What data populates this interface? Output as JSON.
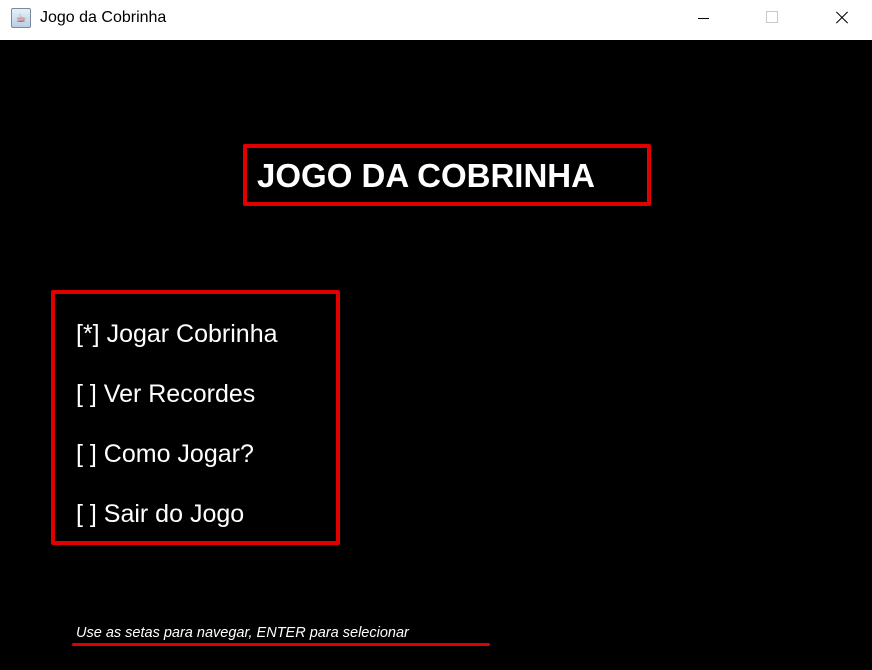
{
  "window": {
    "title": "Jogo da Cobrinha",
    "icon": "java-cup-icon",
    "controls": [
      "minimize",
      "maximize",
      "close"
    ]
  },
  "game": {
    "title": "JOGO DA COBRINHA",
    "menu": {
      "items": [
        {
          "label": "[*] Jogar Cobrinha",
          "selected": true
        },
        {
          "label": "[ ] Ver Recordes",
          "selected": false
        },
        {
          "label": "[ ] Como Jogar?",
          "selected": false
        },
        {
          "label": "[ ] Sair do Jogo",
          "selected": false
        }
      ]
    },
    "hint": "Use as setas para navegar, ENTER para selecionar"
  },
  "colors": {
    "background": "#000000",
    "text": "#ffffff",
    "accent": "#e10000"
  }
}
